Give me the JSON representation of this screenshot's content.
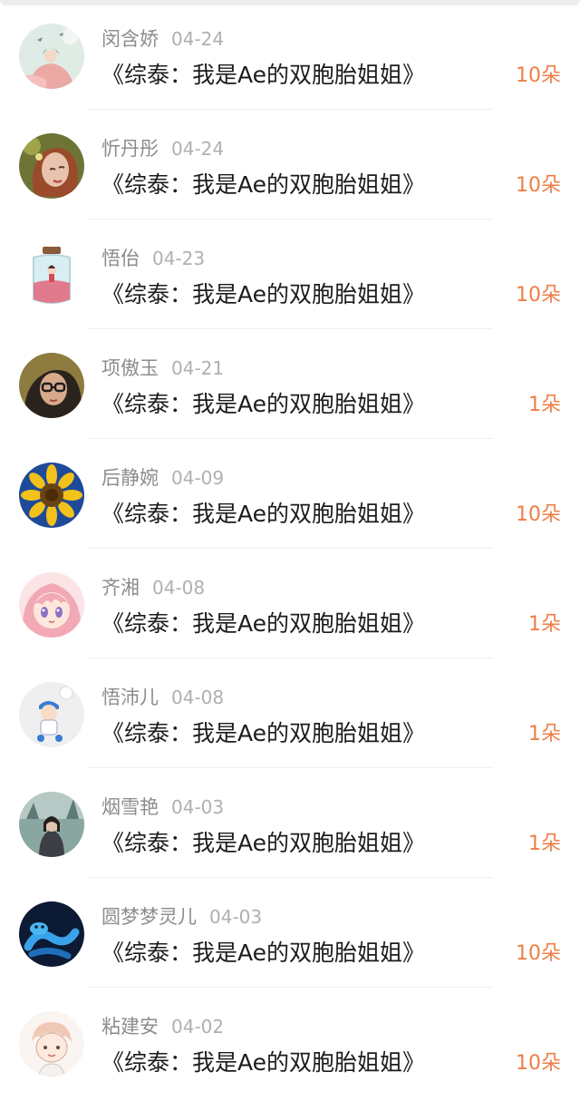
{
  "items": [
    {
      "name": "闵含娇",
      "date": "04-24",
      "title": "《综泰：我是Ae的双胞胎姐姐》",
      "amount": "10朵",
      "avatar_icon": "girl-with-birds-avatar"
    },
    {
      "name": "忻丹彤",
      "date": "04-24",
      "title": "《综泰：我是Ae的双胞胎姐姐》",
      "amount": "10朵",
      "avatar_icon": "redhead-portrait-avatar"
    },
    {
      "name": "悟佁",
      "date": "04-23",
      "title": "《综泰：我是Ae的双胞胎姐姐》",
      "amount": "10朵",
      "avatar_icon": "girl-in-jar-avatar"
    },
    {
      "name": "项傲玉",
      "date": "04-21",
      "title": "《综泰：我是Ae的双胞胎姐姐》",
      "amount": "1朵",
      "avatar_icon": "glasses-girl-avatar"
    },
    {
      "name": "后静婉",
      "date": "04-09",
      "title": "《综泰：我是Ae的双胞胎姐姐》",
      "amount": "10朵",
      "avatar_icon": "sunflower-avatar"
    },
    {
      "name": "齐湘",
      "date": "04-08",
      "title": "《综泰：我是Ae的双胞胎姐姐》",
      "amount": "1朵",
      "avatar_icon": "anime-pink-hair-avatar"
    },
    {
      "name": "悟沛儿",
      "date": "04-08",
      "title": "《综泰：我是Ae的双胞胎姐姐》",
      "amount": "1朵",
      "avatar_icon": "cartoon-boy-avatar"
    },
    {
      "name": "烟雪艳",
      "date": "04-03",
      "title": "《综泰：我是Ae的双胞胎姐姐》",
      "amount": "1朵",
      "avatar_icon": "girl-photo-avatar"
    },
    {
      "name": "圆梦梦灵儿",
      "date": "04-03",
      "title": "《综泰：我是Ae的双胞胎姐姐》",
      "amount": "10朵",
      "avatar_icon": "blue-snake-avatar"
    },
    {
      "name": "粘建安",
      "date": "04-02",
      "title": "《综泰：我是Ae的双胞胎姐姐》",
      "amount": "10朵",
      "avatar_icon": "chibi-boy-avatar"
    }
  ],
  "colors": {
    "amount": "#ee7e45",
    "name": "#8c8c8c",
    "date": "#b0b0b0",
    "title": "#1c1c1c"
  }
}
